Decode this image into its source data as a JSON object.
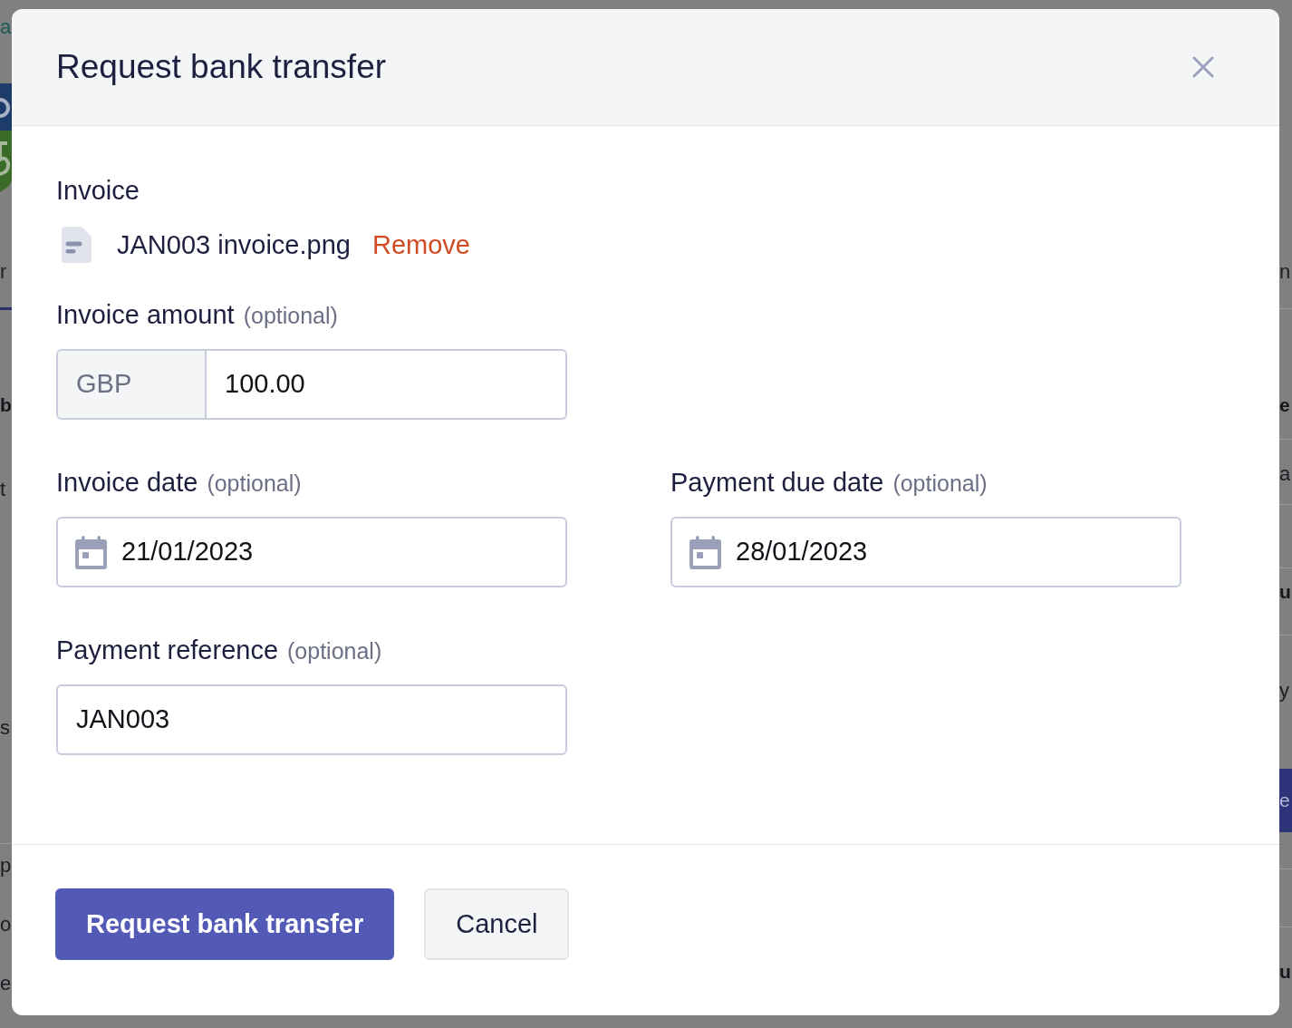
{
  "backdrop": {
    "left_fragments": [
      {
        "text": "a",
        "kind": "link"
      },
      {
        "text": "r",
        "kind": "text"
      },
      {
        "text": "b",
        "kind": "heading"
      },
      {
        "text": "t",
        "kind": "text"
      },
      {
        "text": "s",
        "kind": "text"
      },
      {
        "text": "p",
        "kind": "text"
      },
      {
        "text": "o",
        "kind": "text"
      },
      {
        "text": "e",
        "kind": "text"
      }
    ],
    "right_fragments": [
      {
        "text": "n",
        "kind": "text"
      },
      {
        "text": "e",
        "kind": "heading"
      },
      {
        "text": "a",
        "kind": "text"
      },
      {
        "text": "u",
        "kind": "heading"
      },
      {
        "text": "y",
        "kind": "text"
      },
      {
        "text": "e",
        "kind": "button"
      },
      {
        "text": "u",
        "kind": "heading"
      }
    ]
  },
  "dialog": {
    "title": "Request bank transfer",
    "attachment": {
      "label": "Invoice",
      "file_name": "JAN003 invoice.png",
      "action": "Remove"
    },
    "field_rows": [
      [
        {
          "kind": "currency",
          "label": "Invoice amount",
          "hint": "(optional)",
          "prefix": "GBP",
          "value": "100.00"
        }
      ],
      [
        {
          "kind": "date",
          "label": "Invoice date",
          "hint": "(optional)",
          "value": "21/01/2023"
        },
        {
          "kind": "date",
          "label": "Payment due date",
          "hint": "(optional)",
          "value": "28/01/2023"
        }
      ],
      [
        {
          "kind": "text",
          "label": "Payment reference",
          "hint": "(optional)",
          "value": "JAN003"
        }
      ]
    ],
    "buttons": [
      {
        "label": "Request bank transfer",
        "kind": "primary"
      },
      {
        "label": "Cancel",
        "kind": "secondary"
      }
    ]
  }
}
